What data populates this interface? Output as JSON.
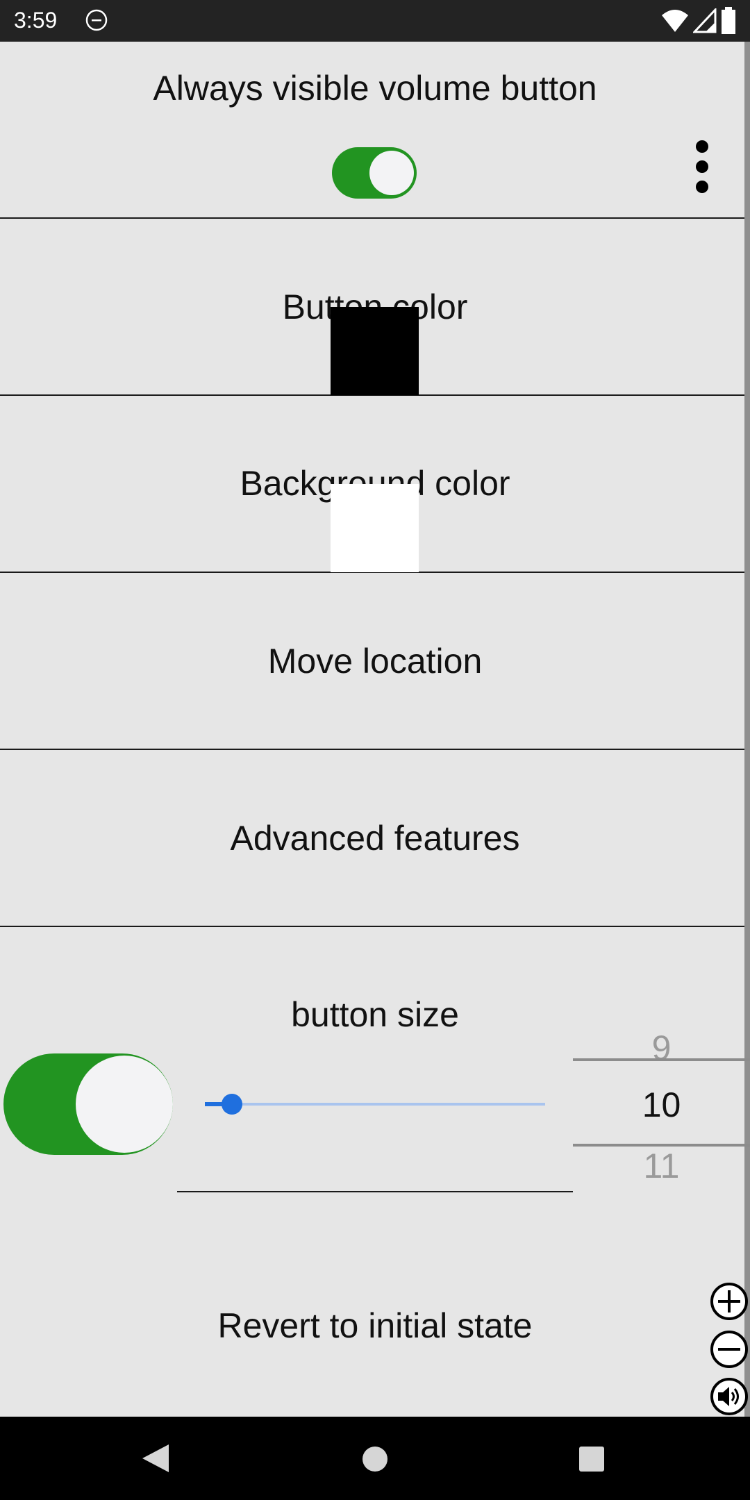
{
  "status": {
    "time": "3:59"
  },
  "sections": {
    "always_visible": {
      "title": "Always visible volume button",
      "toggle_on": true
    },
    "button_color": {
      "title": "Button color",
      "swatch_color": "#000000"
    },
    "background_color": {
      "title": "Background color",
      "swatch_color": "#ffffff"
    },
    "move_location": {
      "title": "Move location"
    },
    "advanced_features": {
      "title": "Advanced features"
    },
    "button_size": {
      "title": "button size",
      "toggle_on": true,
      "slider_fraction": 0.08,
      "picker": {
        "prev": "9",
        "current": "10",
        "next": "11"
      }
    },
    "revert": {
      "title": "Revert to initial state"
    }
  },
  "icons": {
    "menu": "more-vert-icon",
    "zoom_in": "plus-circle-icon",
    "zoom_out": "minus-circle-icon",
    "volume": "speaker-icon"
  },
  "colors": {
    "accent_green": "#229421",
    "slider_blue": "#1f6fde",
    "background": "#e6e6e6"
  }
}
